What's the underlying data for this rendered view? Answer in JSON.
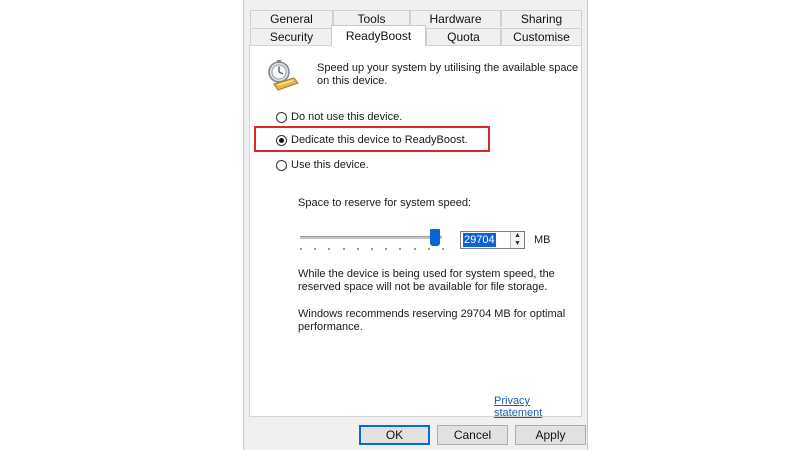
{
  "tabs_row1": [
    "General",
    "Tools",
    "Hardware",
    "Sharing"
  ],
  "tabs_row2": [
    "Security",
    "ReadyBoost",
    "Quota",
    "Customise"
  ],
  "active_tab": "ReadyBoost",
  "icon": "readyboost-drive-icon",
  "intro_text": "Speed up your system by utilising the available space on this device.",
  "options": [
    {
      "label": "Do not use this device.",
      "checked": false
    },
    {
      "label": "Dedicate this device to ReadyBoost.",
      "checked": true
    },
    {
      "label": "Use this device.",
      "checked": false
    }
  ],
  "highlight_color": "#e0242b",
  "reserve_label": "Space to reserve for system speed:",
  "slider_value_fraction": 0.95,
  "spin_value": "29704",
  "unit": "MB",
  "note1": "While the device is being used for system speed, the reserved space will not be available for file storage.",
  "note2": "Windows recommends reserving 29704 MB for optimal performance.",
  "privacy_link": "Privacy statement",
  "buttons": {
    "ok": "OK",
    "cancel": "Cancel",
    "apply": "Apply"
  },
  "accent_color": "#0b63d6"
}
